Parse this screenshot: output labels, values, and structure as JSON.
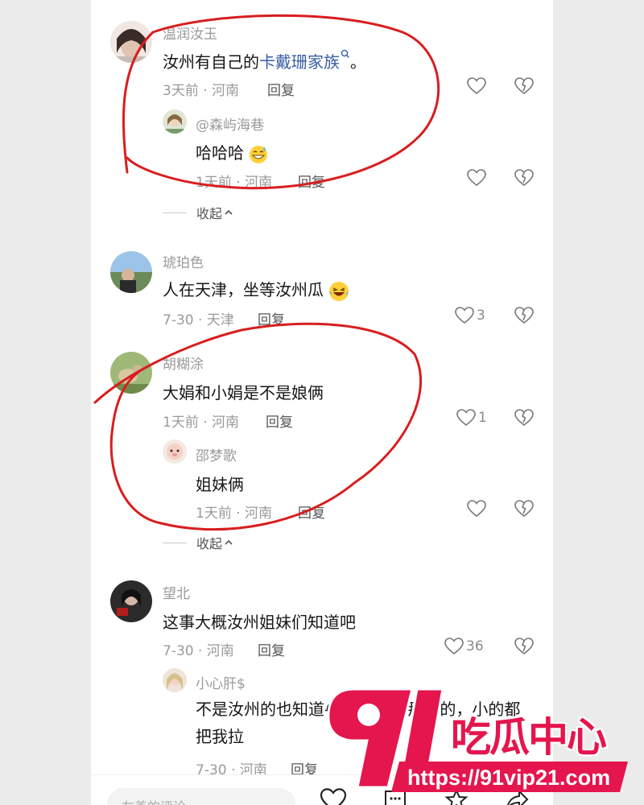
{
  "comments": [
    {
      "user": "温润汝玉",
      "text_before": "汝州有自己的",
      "link": "卡戴珊家族",
      "text_after": "。",
      "time": "3天前 · 河南",
      "reply_label": "回复",
      "replies": [
        {
          "user": "@森屿海巷",
          "text": "哈哈哈",
          "time": "1天前 · 河南",
          "reply_label": "回复"
        }
      ],
      "collapse_label": "收起"
    },
    {
      "user": "琥珀色",
      "text": "人在天津，坐等汝州瓜",
      "time": "7-30 · 天津",
      "reply_label": "回复",
      "likes": "3"
    },
    {
      "user": "胡糊涂",
      "text": "大娟和小娟是不是娘俩",
      "time": "1天前 · 河南",
      "reply_label": "回复",
      "likes": "1",
      "replies": [
        {
          "user": "邵梦歌",
          "text": "姐妹俩",
          "time": "1天前 · 河南",
          "reply_label": "回复"
        }
      ],
      "collapse_label": "收起"
    },
    {
      "user": "望北",
      "text": "这事大概汝州姐妹们知道吧",
      "time": "7-30 · 河南",
      "reply_label": "回复",
      "likes": "36",
      "replies": [
        {
          "user": "小心肝$",
          "text": "不是汝州的也知道😂就这一句那男的，小的都把我拉",
          "time": "7-30 · 河南",
          "reply_label": "回复"
        }
      ]
    }
  ],
  "bottom": {
    "placeholder": "友善的评论"
  },
  "watermark": {
    "number": "91",
    "title": "吃瓜中心",
    "url": "https://91vip21.com"
  },
  "colors": {
    "accent_link": "#3a5ea7",
    "annotation": "#d81e1e",
    "watermark": "#e5154d"
  },
  "icons": [
    "heart-icon",
    "dislike-icon",
    "search-icon",
    "chevron-up-icon",
    "comment-icon",
    "star-icon",
    "share-icon"
  ]
}
